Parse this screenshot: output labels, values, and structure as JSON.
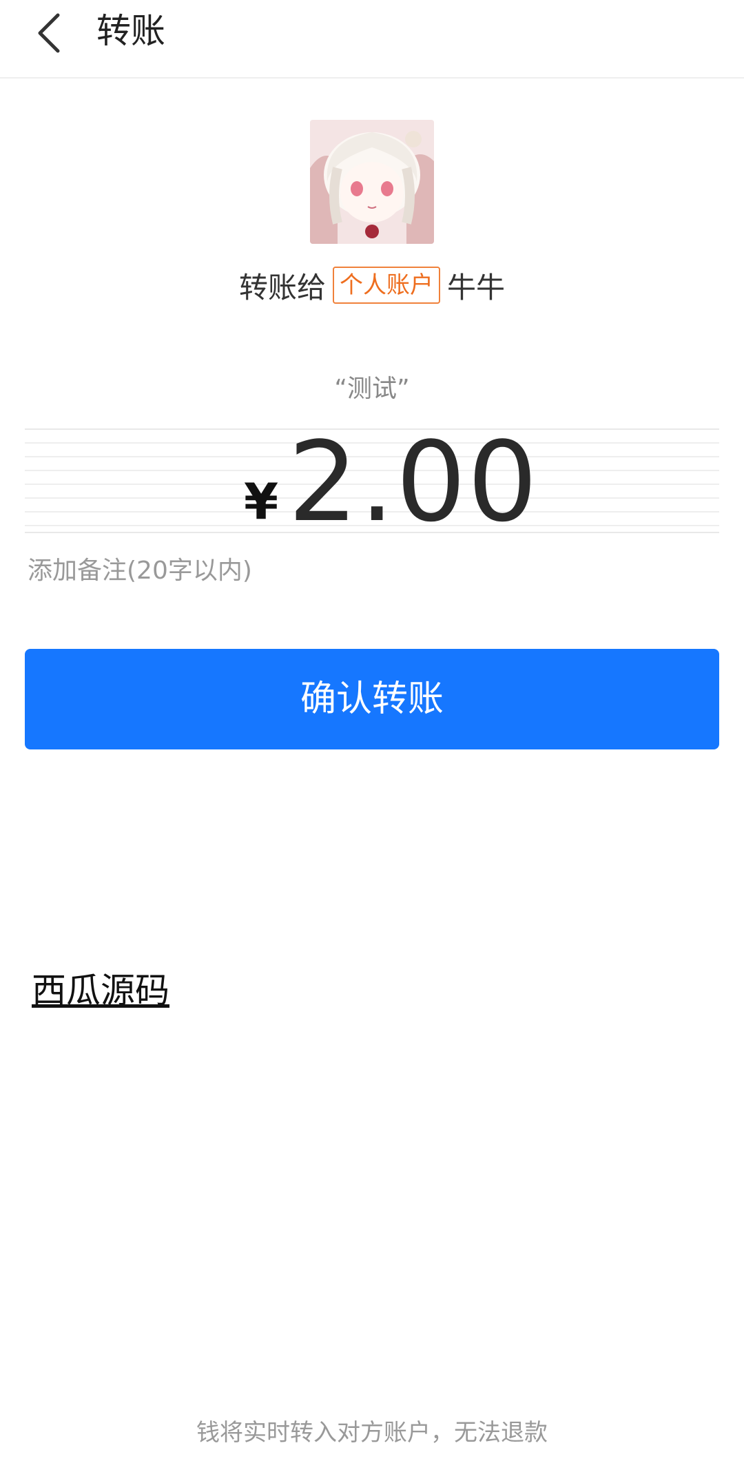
{
  "header": {
    "back_icon": "chevron-left-icon",
    "title": "转账"
  },
  "recipient": {
    "avatar_desc": "avatar-image",
    "prefix": "转账给",
    "account_type": "个人账户",
    "name": "牛牛"
  },
  "memo_quote": "“测试”",
  "amount": {
    "currency_symbol": "¥",
    "value": "2.00"
  },
  "remark": {
    "placeholder": "添加备注(20字以内)"
  },
  "confirm_button": {
    "label": "确认转账"
  },
  "watermark_link": "西瓜源码",
  "footer_note": "钱将实时转入对方账户，无法退款",
  "colors": {
    "primary": "#1677ff",
    "badge": "#ee6e1f",
    "muted_text": "#999999"
  }
}
